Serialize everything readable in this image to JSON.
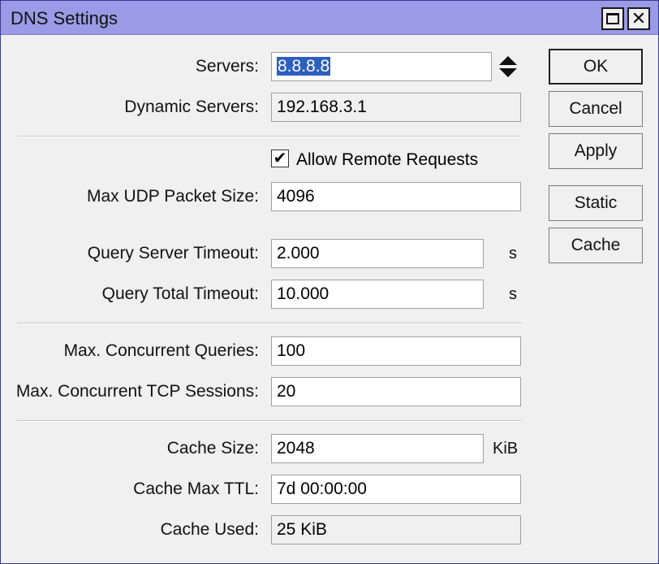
{
  "window": {
    "title": "DNS Settings"
  },
  "fields": {
    "servers": {
      "label": "Servers:",
      "value": "8.8.8.8"
    },
    "dynamic_servers": {
      "label": "Dynamic Servers:",
      "value": "192.168.3.1"
    },
    "allow_remote": {
      "label": "Allow Remote Requests",
      "checked": true
    },
    "max_udp": {
      "label": "Max UDP Packet Size:",
      "value": "4096"
    },
    "query_server_timeout": {
      "label": "Query Server Timeout:",
      "value": "2.000",
      "unit": "s"
    },
    "query_total_timeout": {
      "label": "Query Total Timeout:",
      "value": "10.000",
      "unit": "s"
    },
    "max_concurrent_queries": {
      "label": "Max. Concurrent Queries:",
      "value": "100"
    },
    "max_concurrent_tcp": {
      "label": "Max. Concurrent TCP Sessions:",
      "value": "20"
    },
    "cache_size": {
      "label": "Cache Size:",
      "value": "2048",
      "unit": "KiB"
    },
    "cache_max_ttl": {
      "label": "Cache Max TTL:",
      "value": "7d 00:00:00"
    },
    "cache_used": {
      "label": "Cache Used:",
      "value": "25 KiB"
    }
  },
  "buttons": {
    "ok": "OK",
    "cancel": "Cancel",
    "apply": "Apply",
    "static": "Static",
    "cache": "Cache"
  },
  "icons": {
    "checkmark": "✔",
    "close": "✕"
  }
}
